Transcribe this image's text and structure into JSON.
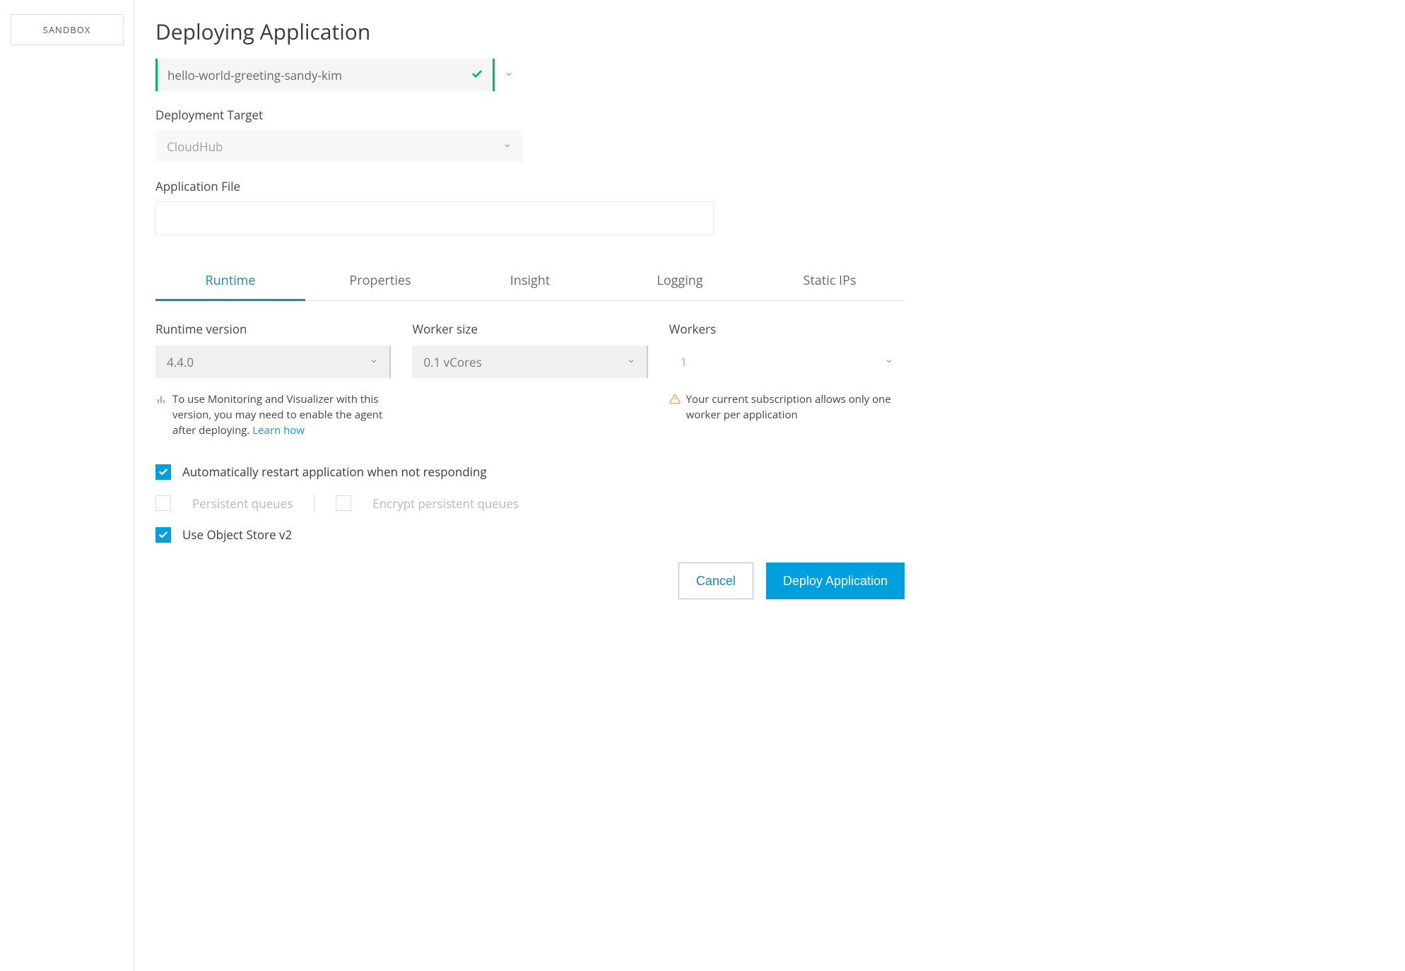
{
  "sidebar": {
    "environment_label": "SANDBOX"
  },
  "page": {
    "title": "Deploying Application"
  },
  "app_name": {
    "value": "hello-world-greeting-sandy-kim",
    "valid": true
  },
  "deployment_target": {
    "label": "Deployment Target",
    "value": "CloudHub"
  },
  "application_file": {
    "label": "Application File",
    "value": ""
  },
  "tabs": [
    {
      "label": "Runtime",
      "active": true
    },
    {
      "label": "Properties",
      "active": false
    },
    {
      "label": "Insight",
      "active": false
    },
    {
      "label": "Logging",
      "active": false
    },
    {
      "label": "Static IPs",
      "active": false
    }
  ],
  "runtime": {
    "version": {
      "label": "Runtime version",
      "value": "4.4.0"
    },
    "worker_size": {
      "label": "Worker size",
      "value": "0.1 vCores"
    },
    "workers": {
      "label": "Workers",
      "value": "1"
    },
    "monitoring_hint": "To use Monitoring and Visualizer with this version, you may need to enable the agent after deploying.",
    "monitoring_link": "Learn how",
    "subscription_hint": "Your current subscription allows only one worker per application",
    "checkboxes": {
      "auto_restart": {
        "label": "Automatically restart application when not responding",
        "checked": true,
        "disabled": false
      },
      "persistent_queues": {
        "label": "Persistent queues",
        "checked": false,
        "disabled": true
      },
      "encrypt_queues": {
        "label": "Encrypt persistent queues",
        "checked": false,
        "disabled": true
      },
      "object_store": {
        "label": "Use Object Store v2",
        "checked": true,
        "disabled": false
      }
    }
  },
  "footer": {
    "cancel": "Cancel",
    "deploy": "Deploy Application"
  }
}
